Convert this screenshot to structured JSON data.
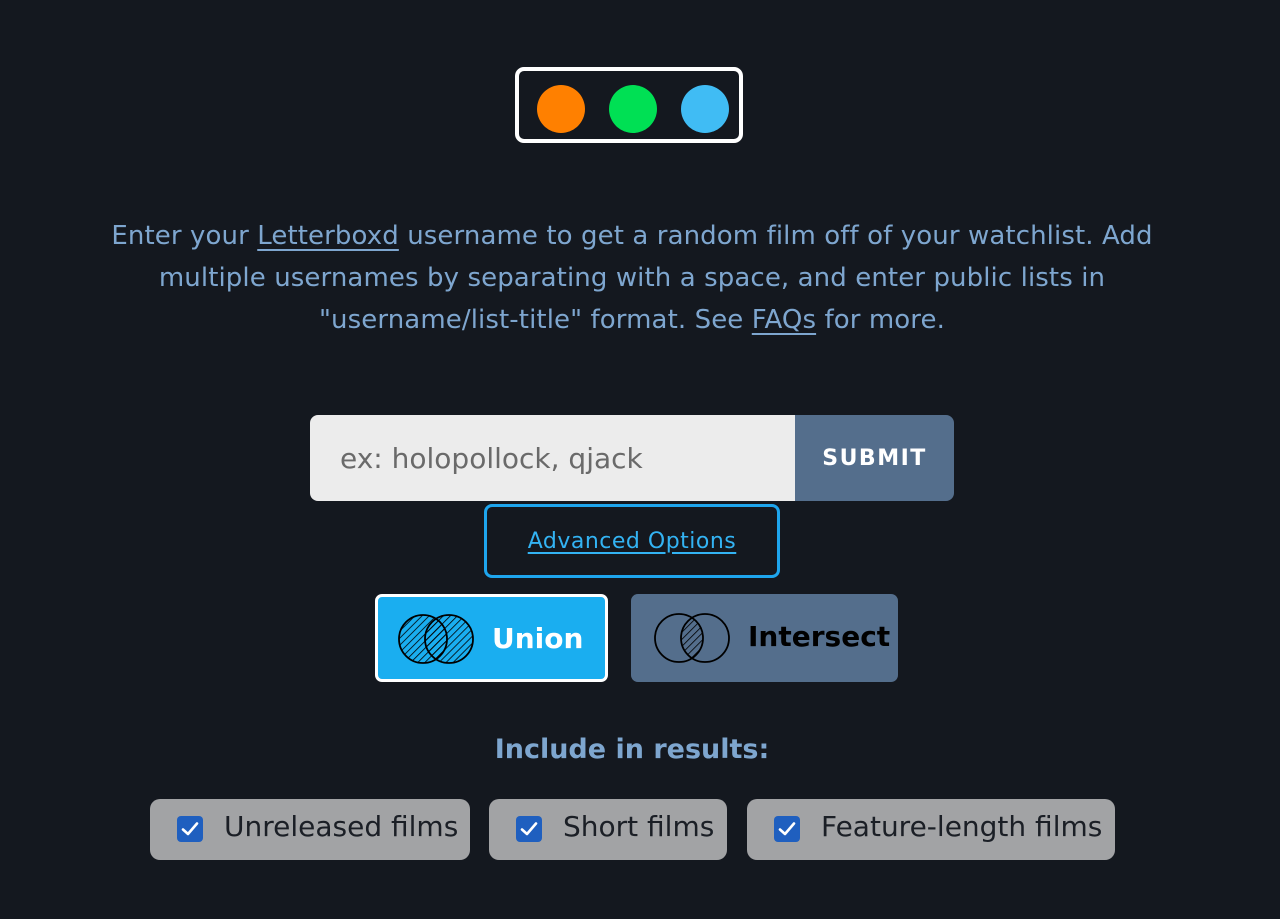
{
  "colors": {
    "background": "#14181f",
    "text_accent": "#7ea6cf",
    "logo_dots": [
      "#ff8000",
      "#00e054",
      "#40bcf4"
    ],
    "union_active": "#1aaef0",
    "intersect_inactive": "#546e8c",
    "submit_bg": "#546e8c",
    "checkbox_checked": "#1f5fbf"
  },
  "intro": {
    "part1": "Enter your ",
    "link1": "Letterboxd",
    "part2": " username to get a random film off of your watchlist. Add multiple usernames by separating with a space, and enter public lists in \"username/list-title\" format. See ",
    "link2": "FAQs",
    "part3": " for more."
  },
  "search": {
    "placeholder": "ex: holopollock, qjack",
    "value": "",
    "submit_label": "SUBMIT"
  },
  "advanced": {
    "label": "Advanced Options"
  },
  "mode": {
    "options": [
      {
        "label": "Union",
        "icon": "venn-union-icon",
        "selected": true
      },
      {
        "label": "Intersect",
        "icon": "venn-intersect-icon",
        "selected": false
      }
    ]
  },
  "filters": {
    "title": "Include in results:",
    "options": [
      {
        "label": "Unreleased films",
        "checked": true
      },
      {
        "label": "Short films",
        "checked": true
      },
      {
        "label": "Feature-length films",
        "checked": true
      }
    ]
  }
}
